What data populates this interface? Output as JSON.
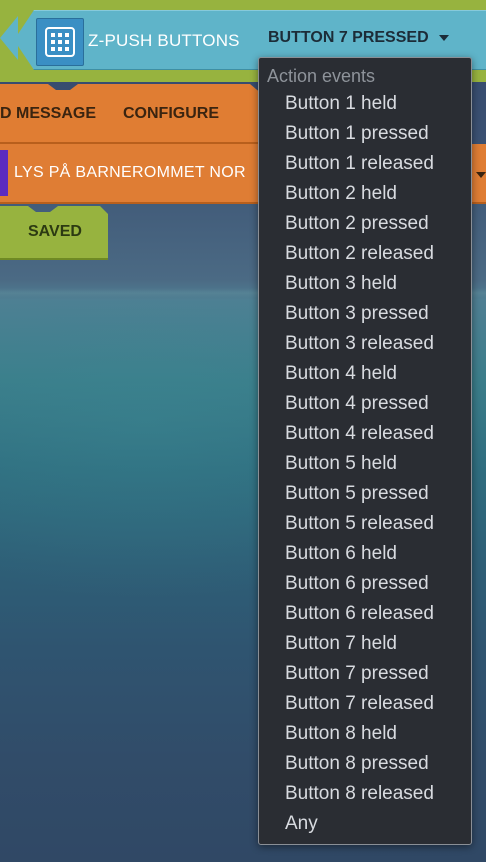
{
  "trigger_block": {
    "icon": "grid-icon",
    "device_type": "Z-PUSH BUTTONS",
    "selected_event": "BUTTON 7 PRESSED"
  },
  "action_block": {
    "label": "D MESSAGE",
    "configure_label": "CONFIGURE"
  },
  "target_block": {
    "device_name": "LYS PÅ BARNEROMMET NOR"
  },
  "status_block": {
    "label": "SAVED"
  },
  "dropdown": {
    "header": "Action events",
    "items": [
      "Button 1 held",
      "Button 1 pressed",
      "Button 1 released",
      "Button 2 held",
      "Button 2 pressed",
      "Button 2 released",
      "Button 3 held",
      "Button 3 pressed",
      "Button 3 released",
      "Button 4 held",
      "Button 4 pressed",
      "Button 4 released",
      "Button 5 held",
      "Button 5 pressed",
      "Button 5 released",
      "Button 6 held",
      "Button 6 pressed",
      "Button 6 released",
      "Button 7 held",
      "Button 7 pressed",
      "Button 7 released",
      "Button 8 held",
      "Button 8 pressed",
      "Button 8 released",
      "Any"
    ]
  },
  "colors": {
    "trigger_block": "#5fb4c9",
    "action_block": "#e07d33",
    "saved_block": "#97b33f",
    "device_icon": "#3a8fc4",
    "menu_background": "#2a2d33",
    "menu_text": "#d8dbe0",
    "menu_header_text": "#8e939a"
  }
}
